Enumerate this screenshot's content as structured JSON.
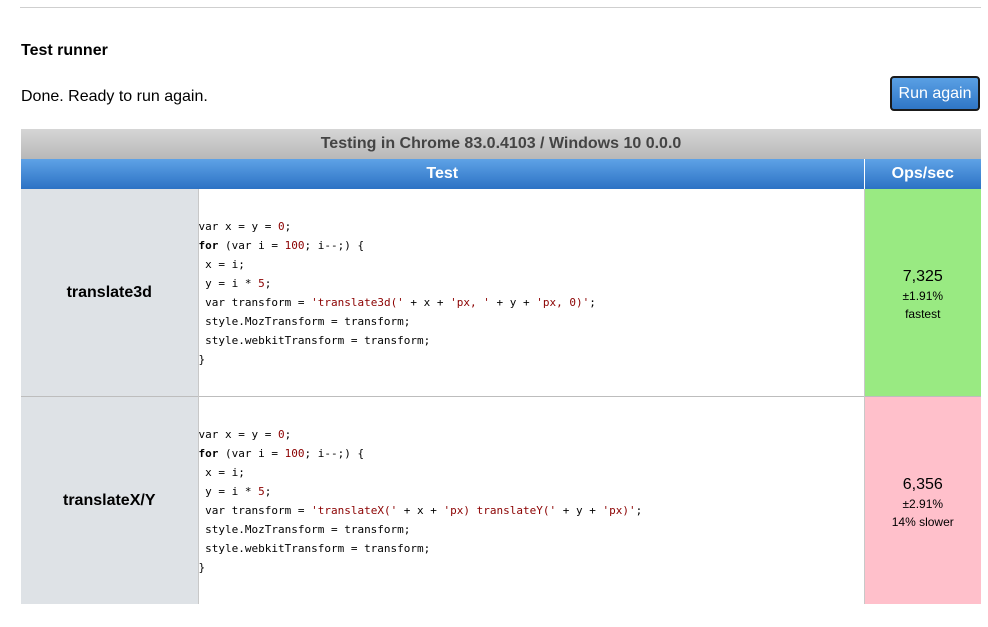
{
  "header": {
    "section_title": "Test runner",
    "status": "Done. Ready to run again.",
    "run_button": "Run again"
  },
  "table": {
    "caption": "Testing in Chrome 83.0.4103 / Windows 10 0.0.0",
    "col_test": "Test",
    "col_ops": "Ops/sec",
    "rows": [
      {
        "name": "translate3d",
        "code_lines": [
          "var x = y = 0;",
          "for (var i = 100; i--;) {",
          " x = i;",
          " y = i * 5;",
          " var transform = 'translate3d(' + x + 'px, ' + y + 'px, 0)';",
          " style.MozTransform = transform;",
          " style.webkitTransform = transform;",
          "}"
        ],
        "ops": "7,325",
        "error": "±1.91%",
        "rank": "fastest",
        "result_color": "#99ea82"
      },
      {
        "name": "translateX/Y",
        "code_lines": [
          "var x = y = 0;",
          "for (var i = 100; i--;) {",
          " x = i;",
          " y = i * 5;",
          " var transform = 'translateX(' + x + 'px) translateY(' + y + 'px)';",
          " style.MozTransform = transform;",
          " style.webkitTransform = transform;",
          "}"
        ],
        "ops": "6,356",
        "error": "±2.91%",
        "rank": "14% slower",
        "result_color": "#ffc0cb"
      }
    ]
  },
  "colors": {
    "header_blue": "#2f76c6",
    "name_cell_bg": "#dee2e6",
    "fastest_bg": "#99ea82",
    "slower_bg": "#ffc0cb"
  }
}
